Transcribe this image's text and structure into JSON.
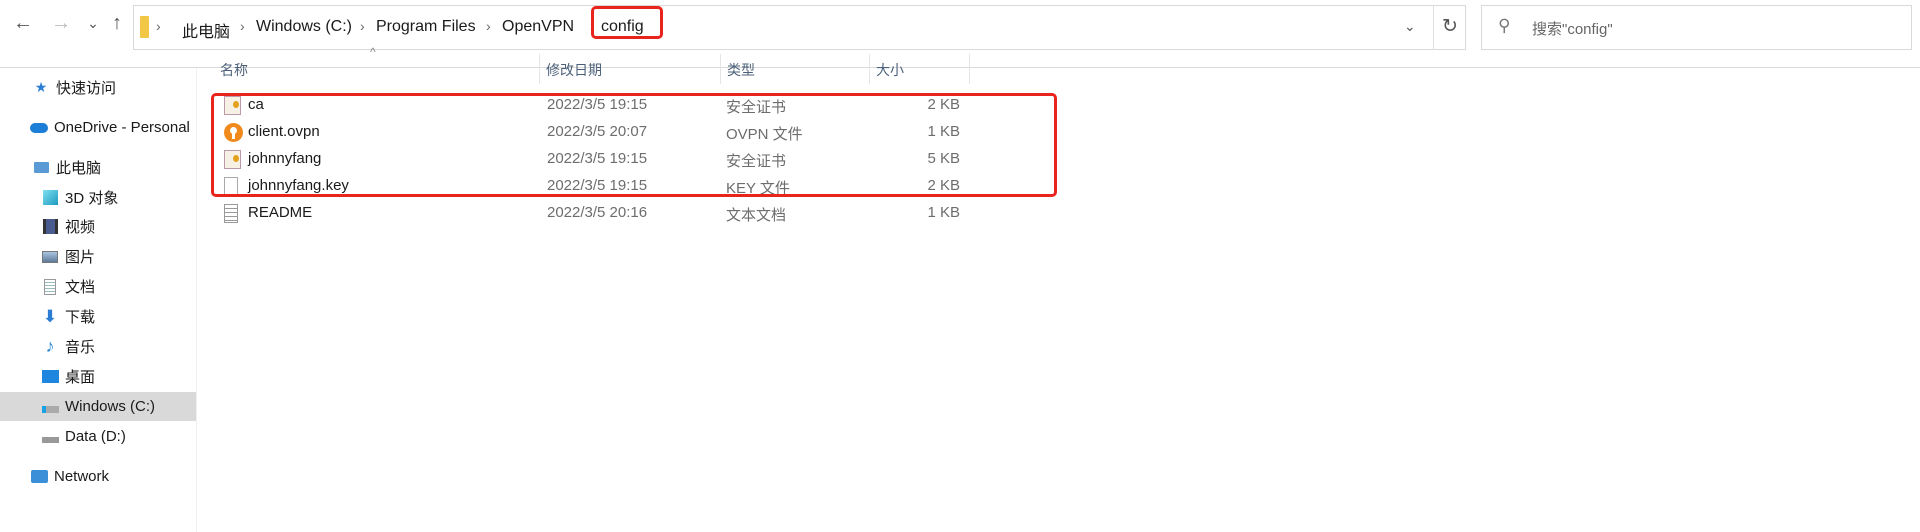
{
  "nav": {
    "back": "←",
    "forward": "→",
    "recent": "⌄",
    "up": "↑"
  },
  "address": {
    "crumbs": [
      "此电脑",
      "Windows (C:)",
      "Program Files",
      "OpenVPN",
      "config"
    ],
    "separator": "›",
    "dropdown": "⌄",
    "refresh": "↻"
  },
  "search": {
    "placeholder": "搜索\"config\"",
    "icon": "search-icon"
  },
  "sidebar": {
    "items": [
      {
        "label": "快速访问",
        "icon": "star-icon"
      },
      {
        "label": "OneDrive - Personal",
        "icon": "cloud-icon"
      },
      {
        "label": "此电脑",
        "icon": "computer-icon"
      },
      {
        "label": "3D 对象",
        "icon": "cube-icon"
      },
      {
        "label": "视频",
        "icon": "video-icon"
      },
      {
        "label": "图片",
        "icon": "picture-icon"
      },
      {
        "label": "文档",
        "icon": "document-icon"
      },
      {
        "label": "下载",
        "icon": "download-icon"
      },
      {
        "label": "音乐",
        "icon": "music-icon"
      },
      {
        "label": "桌面",
        "icon": "desktop-icon"
      },
      {
        "label": "Windows (C:)",
        "icon": "drive-icon",
        "selected": true
      },
      {
        "label": "Data (D:)",
        "icon": "drive-icon"
      },
      {
        "label": "Network",
        "icon": "network-icon"
      }
    ]
  },
  "columns": {
    "name": "名称",
    "date": "修改日期",
    "type": "类型",
    "size": "大小",
    "sort": "^"
  },
  "files": [
    {
      "name": "ca",
      "date": "2022/3/5 19:15",
      "type": "安全证书",
      "size": "2 KB",
      "icon": "certificate-icon"
    },
    {
      "name": "client.ovpn",
      "date": "2022/3/5 20:07",
      "type": "OVPN 文件",
      "size": "1 KB",
      "icon": "openvpn-icon"
    },
    {
      "name": "johnnyfang",
      "date": "2022/3/5 19:15",
      "type": "安全证书",
      "size": "5 KB",
      "icon": "certificate-icon"
    },
    {
      "name": "johnnyfang.key",
      "date": "2022/3/5 19:15",
      "type": "KEY 文件",
      "size": "2 KB",
      "icon": "file-icon"
    },
    {
      "name": "README",
      "date": "2022/3/5 20:16",
      "type": "文本文档",
      "size": "1 KB",
      "icon": "text-file-icon"
    }
  ],
  "colors": {
    "highlight": "#e8241c",
    "selected": "#d9d9d9",
    "header_text": "#4c607a"
  }
}
